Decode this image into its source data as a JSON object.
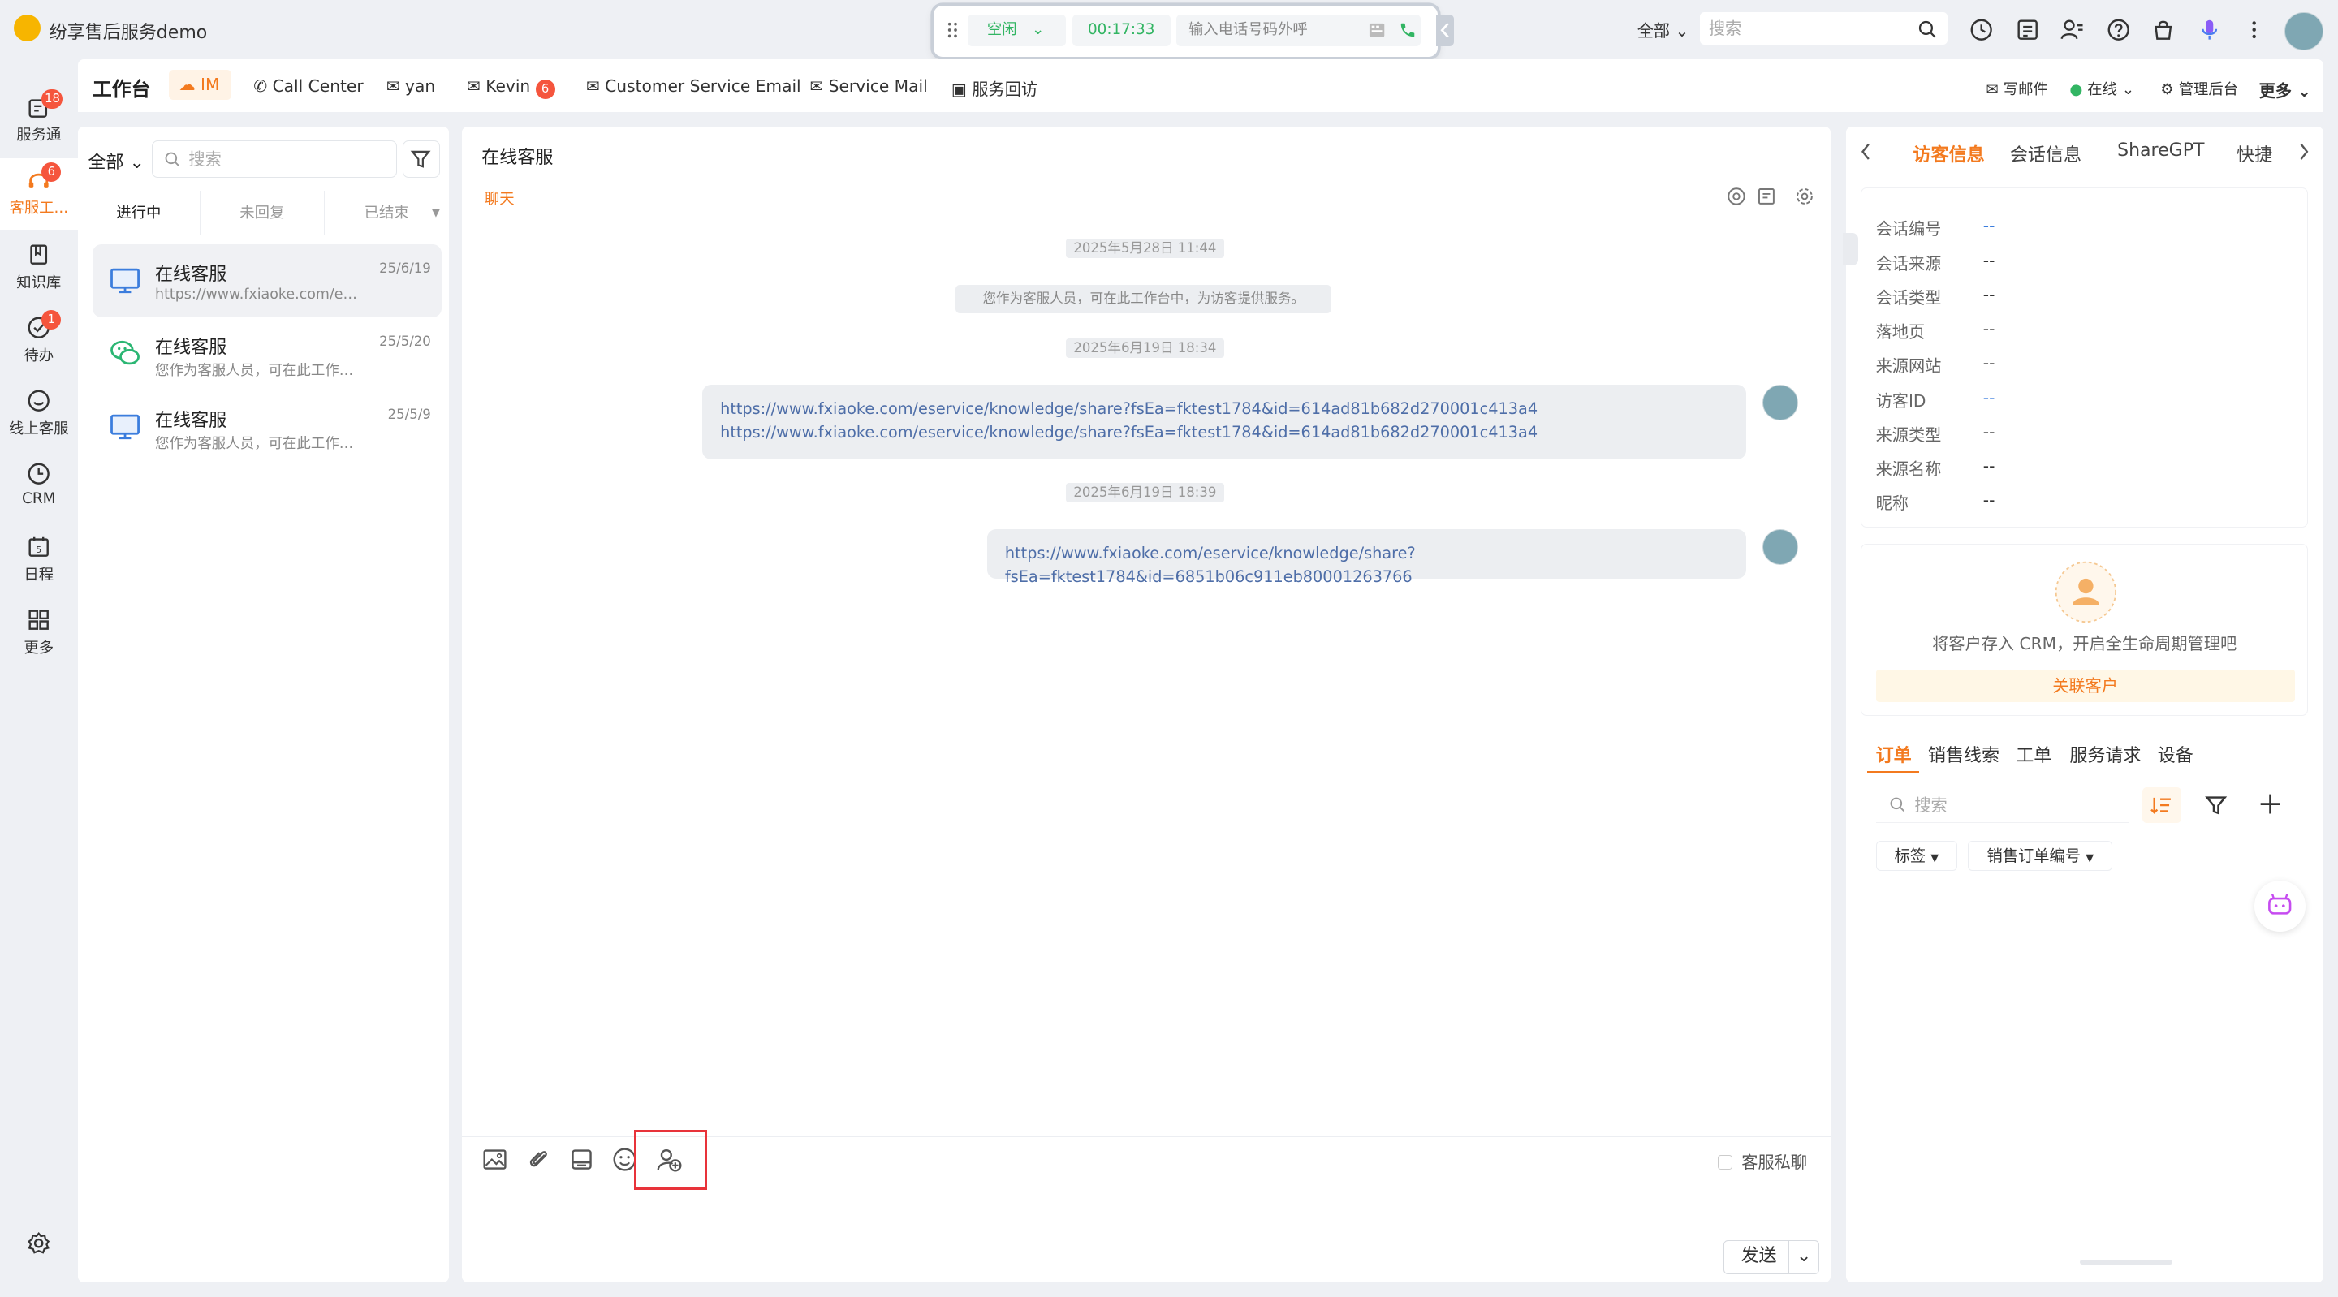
{
  "app": {
    "title": "纷享售后服务demo"
  },
  "callbar": {
    "status": "空闲",
    "timer": "00:17:33",
    "dial_placeholder": "输入电话号码外呼"
  },
  "topbar": {
    "scope": "全部",
    "search_placeholder": "搜索"
  },
  "leftnav": {
    "items": [
      {
        "label": "服务通",
        "badge": "18"
      },
      {
        "label": "客服工...",
        "badge": "6"
      },
      {
        "label": "知识库",
        "badge": ""
      },
      {
        "label": "待办",
        "badge": "1"
      },
      {
        "label": "线上客服",
        "badge": ""
      },
      {
        "label": "CRM",
        "badge": ""
      },
      {
        "label": "日程",
        "badge": ""
      },
      {
        "label": "更多",
        "badge": ""
      }
    ]
  },
  "tabs": {
    "workspace": "工作台",
    "im": "IM",
    "call_center": "Call Center",
    "yan": "yan",
    "kevin": "Kevin",
    "kevin_badge": "6",
    "cs_email": "Customer Service Email",
    "service_mail": "Service Mail",
    "revisit": "服务回访",
    "write_mail": "写邮件",
    "online": "在线",
    "admin": "管理后台",
    "more": "更多"
  },
  "conversation_list": {
    "scope": "全部",
    "search_placeholder": "搜索",
    "segments": [
      "进行中",
      "未回复",
      "已结束"
    ],
    "items": [
      {
        "name": "在线客服",
        "date": "25/6/19",
        "preview": "https://www.fxiaoke.com/eservice/knowledge/share"
      },
      {
        "name": "在线客服",
        "date": "25/5/20",
        "preview": "您作为客服人员，可在此工作台中，为访客提供服务。"
      },
      {
        "name": "在线客服",
        "date": "25/5/9",
        "preview": "您作为客服人员，可在此工作台中，为访客提供服务。"
      }
    ]
  },
  "chat": {
    "title": "在线客服",
    "tab": "聊天",
    "stamp1": "2025年5月28日 11:44",
    "system_message": "您作为客服人员，可在此工作台中，为访客提供服务。",
    "stamp2": "2025年6月19日 18:34",
    "msg1_line1": "https://www.fxiaoke.com/eservice/knowledge/share?fsEa=fktest1784&id=614ad81b682d270001c413a4",
    "msg1_line2": "https://www.fxiaoke.com/eservice/knowledge/share?fsEa=fktest1784&id=614ad81b682d270001c413a4",
    "stamp3": "2025年6月19日 18:39",
    "msg2": "https://www.fxiaoke.com/eservice/knowledge/share?fsEa=fktest1784&id=6851b06c911eb80001263766",
    "private_chat": "客服私聊",
    "send": "发送"
  },
  "right": {
    "tabs": [
      "访客信息",
      "会话信息",
      "ShareGPT",
      "快捷"
    ],
    "fields": [
      {
        "label": "会话编号",
        "value": "--"
      },
      {
        "label": "会话来源",
        "value": "--"
      },
      {
        "label": "会话类型",
        "value": "--"
      },
      {
        "label": "落地页",
        "value": "--"
      },
      {
        "label": "来源网站",
        "value": "--"
      },
      {
        "label": "访客ID",
        "value": "--"
      },
      {
        "label": "来源类型",
        "value": "--"
      },
      {
        "label": "来源名称",
        "value": "--"
      },
      {
        "label": "昵称",
        "value": "--"
      }
    ],
    "crm_text": "将客户存入 CRM，开启全生命周期管理吧",
    "crm_button": "关联客户",
    "order_tabs": [
      "订单",
      "销售线索",
      "工单",
      "服务请求",
      "设备"
    ],
    "order_search_placeholder": "搜索",
    "chip_tag": "标签",
    "chip_order_no": "销售订单编号"
  },
  "colors": {
    "accent": "#f37a1f",
    "online": "#32b563",
    "badge": "#f5553d",
    "link": "#4e6ea8",
    "highlight": "#e8333a"
  }
}
